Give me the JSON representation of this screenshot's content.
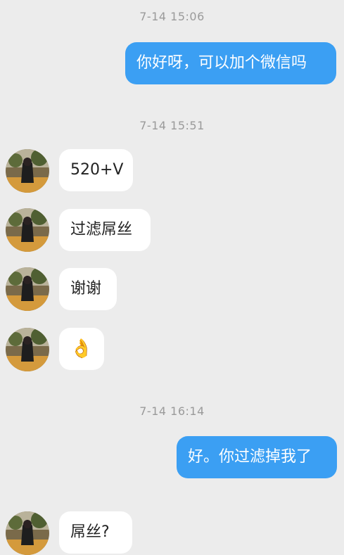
{
  "conversation": {
    "timestamps": [
      "7-14 15:06",
      "7-14 15:51",
      "7-14 16:14"
    ],
    "messages": [
      {
        "from": "me",
        "text": "你好呀，可以加个微信吗"
      },
      {
        "from": "contact",
        "text": "520+V"
      },
      {
        "from": "contact",
        "text": "过滤屌丝"
      },
      {
        "from": "contact",
        "text": "谢谢"
      },
      {
        "from": "contact",
        "text": "👌",
        "icon": "ok-hand-icon"
      },
      {
        "from": "me",
        "text": "好。你过滤掉我了"
      },
      {
        "from": "contact",
        "text": "屌丝?"
      }
    ]
  },
  "colors": {
    "background": "#ececec",
    "outgoing_bubble": "#3b9ff3",
    "incoming_bubble": "#ffffff",
    "timestamp_text": "#9a9a9a"
  }
}
